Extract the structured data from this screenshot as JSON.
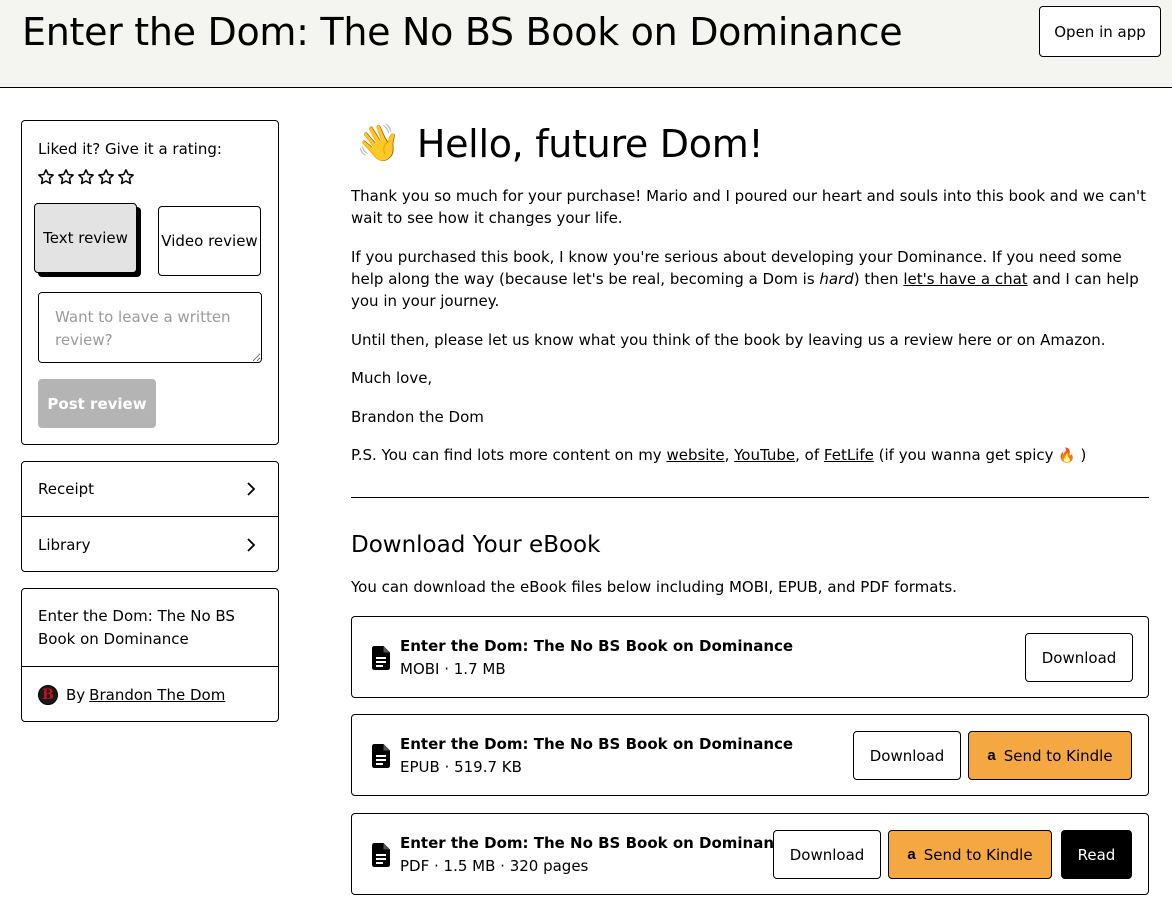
{
  "header": {
    "title": "Enter the Dom: The No BS Book on Dominance",
    "open_app_label": "Open in app"
  },
  "rating": {
    "prompt": "Liked it? Give it a rating:",
    "star_count": 5,
    "text_review_label": "Text review",
    "video_review_label": "Video review",
    "written_placeholder": "Want to leave a written review?",
    "post_label": "Post review"
  },
  "nav": {
    "receipt_label": "Receipt",
    "library_label": "Library"
  },
  "book": {
    "title": "Enter the Dom: The No BS Book on Dominance",
    "by_label": "By",
    "author_initial": "B",
    "author_name": "Brandon The Dom"
  },
  "main": {
    "greeting_emoji": "👋",
    "greeting": "Hello, future Dom!",
    "p1": "Thank you so much for your purchase! Mario and I poured our heart and souls into this book and we can't wait to see how it changes your life.",
    "p2_a": "If you purchased this book, I know you're serious about developing your Dominance. If you need some help along the way (because let's be real, becoming a Dom is ",
    "p2_em": "hard",
    "p2_b": ") then ",
    "p2_link": "let's have a chat",
    "p2_c": " and I can help you in your journey.",
    "p3": "Until then, please let us know what you think of the book by leaving us a review here or on Amazon.",
    "p4": "Much love,",
    "p5": "Brandon the Dom",
    "p6_a": "P.S. You can find lots more content on my ",
    "p6_link1": "website",
    "p6_sep1": ", ",
    "p6_link2": "YouTube",
    "p6_sep2": ", of ",
    "p6_link3": "FetLife",
    "p6_b": " (if you wanna get spicy ",
    "p6_flame": "🔥",
    "p6_c": " )"
  },
  "downloads": {
    "heading": "Download Your eBook",
    "description": "You can download the eBook files below including MOBI, EPUB, and PDF formats.",
    "download_label": "Download",
    "kindle_label": "Send to Kindle",
    "kindle_glyph": "a",
    "read_label": "Read",
    "files": [
      {
        "name": "Enter the Dom: The No BS Book on Dominance",
        "meta": "MOBI · 1.7 MB"
      },
      {
        "name": "Enter the Dom: The No BS Book on Dominance",
        "meta": "EPUB · 519.7 KB"
      },
      {
        "name": "Enter the Dom: The No BS Book on Dominance",
        "meta": "PDF · 1.5 MB · 320 pages"
      }
    ]
  },
  "icons": {
    "star": "star-outline-icon",
    "chevron": "chevron-right-icon",
    "file": "file-text-icon"
  }
}
